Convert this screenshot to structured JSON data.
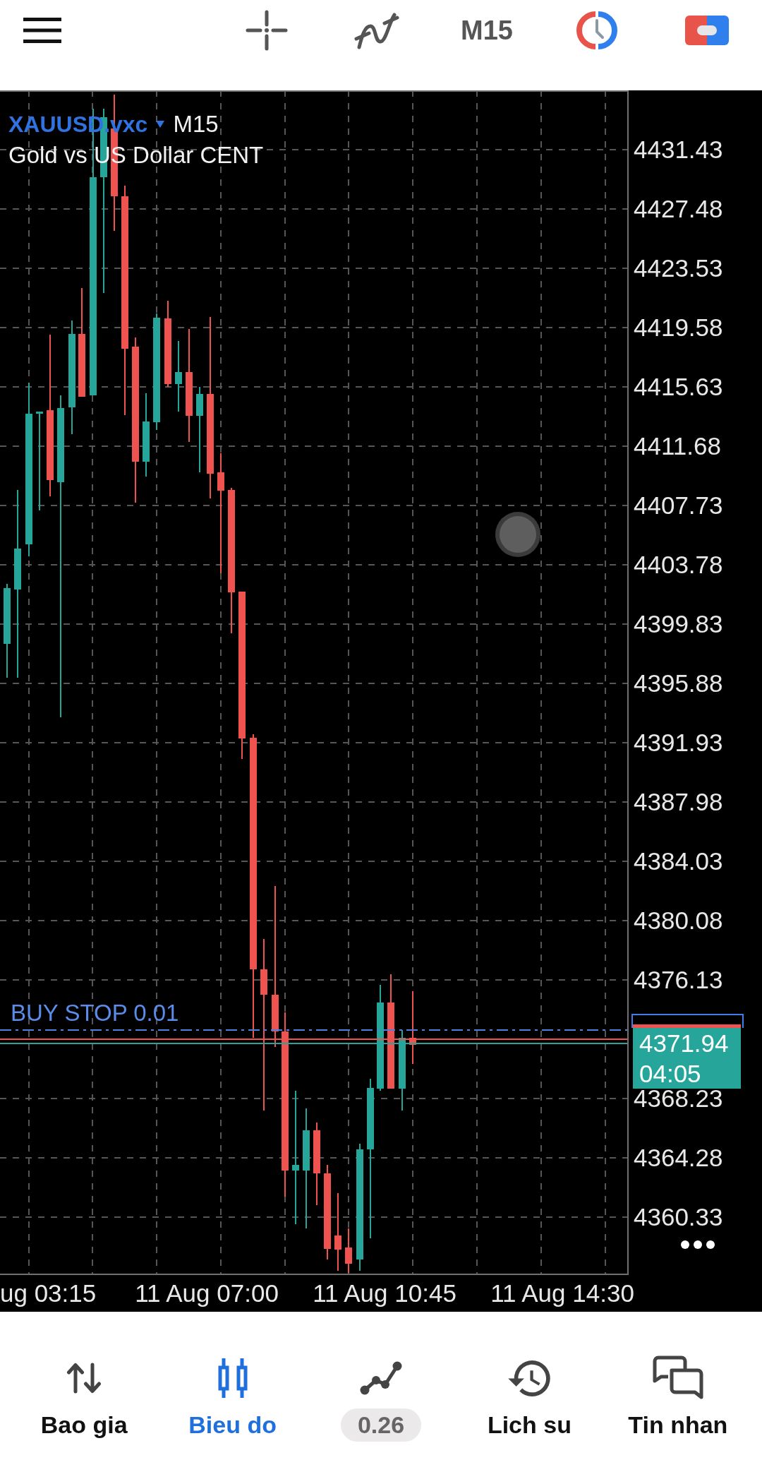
{
  "top_bar": {
    "timeframe": "M15"
  },
  "chart": {
    "symbol": "XAUUSD.vxc",
    "timeframe": "M15",
    "description": "Gold vs US Dollar CENT",
    "pending_order": {
      "label": "BUY STOP 0.01"
    },
    "price_axis": {
      "upper_labels": [
        "4431.43",
        "4427.48",
        "4423.53",
        "4419.58",
        "4415.63",
        "4411.68",
        "4407.73",
        "4403.78",
        "4399.83",
        "4395.88",
        "4391.93",
        "4387.98",
        "4384.03",
        "4380.08",
        "4376.13"
      ],
      "lower_labels": [
        "4368.23",
        "4364.28",
        "4360.33"
      ]
    },
    "current_price": {
      "price": "4371.94",
      "countdown": "04:05"
    },
    "time_axis": {
      "labels": [
        "ug 03:15",
        "11 Aug 07:00",
        "11 Aug 10:45",
        "11 Aug 14:30"
      ]
    }
  },
  "bottom_nav": [
    {
      "kind": "label",
      "label": "Bao gia",
      "selected": false
    },
    {
      "kind": "label",
      "label": "Bieu do",
      "selected": true
    },
    {
      "kind": "pill",
      "label": "0.26",
      "selected": false
    },
    {
      "kind": "label",
      "label": "Lich su",
      "selected": false
    },
    {
      "kind": "label",
      "label": "Tin nhan",
      "selected": false
    }
  ]
}
